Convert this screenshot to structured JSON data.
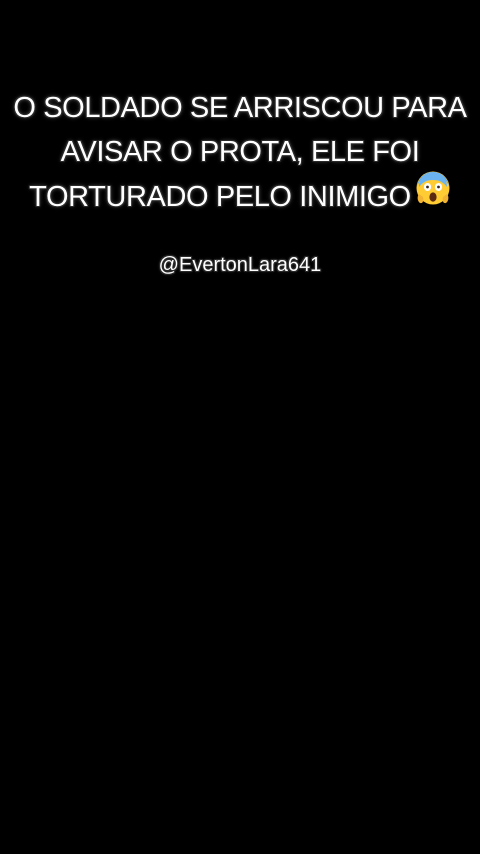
{
  "caption": {
    "lines": [
      "O SOLDADO SE ARRISCOU PARA",
      "AVISAR O PROTA, ELE FOI",
      "TORTURADO PELO INIMIGO"
    ],
    "emoji": "face-screaming-in-fear-icon"
  },
  "handle": "@EvertonLara641",
  "colors": {
    "background": "#000000",
    "text": "#ffffff"
  }
}
